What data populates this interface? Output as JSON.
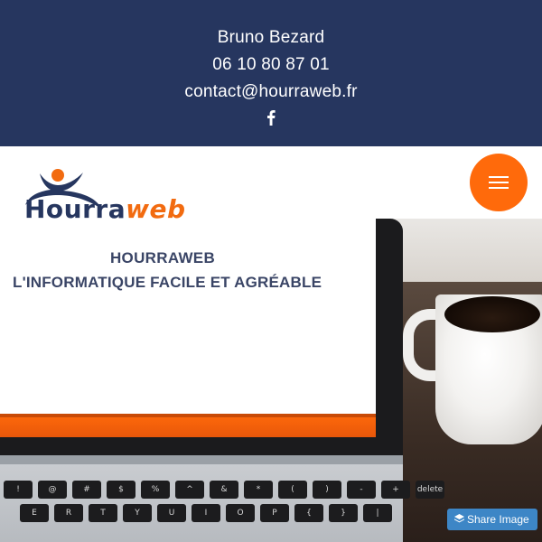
{
  "contact": {
    "name": "Bruno Bezard",
    "phone": "06 10 80 87 01",
    "email": "contact@hourraweb.fr",
    "social_icon": "facebook-icon"
  },
  "header": {
    "logo_text_main": "Hourra",
    "logo_text_accent": "web",
    "menu_icon": "hamburger-menu-icon"
  },
  "hero": {
    "title": "HOURRAWEB",
    "subtitle": "L'INFORMATIQUE FACILE ET AGRÉABLE"
  },
  "keyboard": {
    "row1": [
      "!",
      "@",
      "#",
      "$",
      "%",
      "^",
      "&",
      "*",
      "(",
      ")",
      "-",
      "+",
      "delete"
    ],
    "row2": [
      "E",
      "R",
      "T",
      "Y",
      "U",
      "I",
      "O",
      "P",
      "{",
      "}",
      "|"
    ]
  },
  "share": {
    "label": "Share Image",
    "icon": "layers-icon"
  },
  "colors": {
    "navy": "#26365f",
    "orange": "#ff6a0b",
    "share_blue": "#3d86c6"
  }
}
